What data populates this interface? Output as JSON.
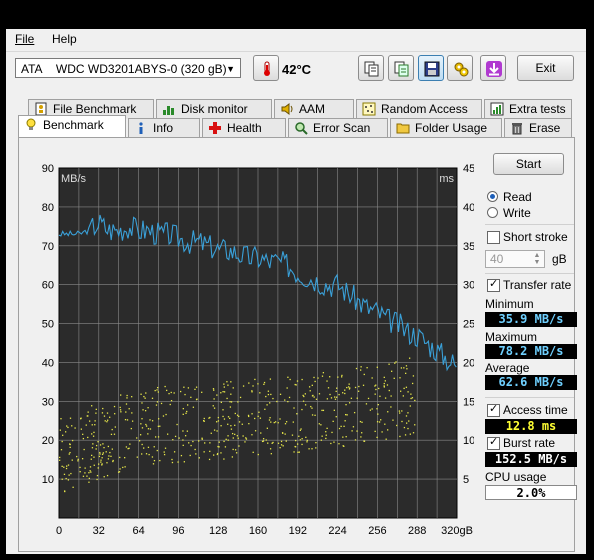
{
  "menu": [
    {
      "label": "File"
    },
    {
      "label": "Help"
    }
  ],
  "drive": {
    "interface": "ATA",
    "model": "WDC WD3201ABYS-0 (320 gB)"
  },
  "temperature": {
    "value": "42",
    "unit": "°C"
  },
  "toolbar": {
    "exit_label": "Exit"
  },
  "tabs_top": [
    "File Benchmark",
    "Disk monitor",
    "AAM",
    "Random Access",
    "Extra tests"
  ],
  "tabs_bottom": [
    "Benchmark",
    "Info",
    "Health",
    "Error Scan",
    "Folder Usage",
    "Erase"
  ],
  "controls": {
    "start_label": "Start",
    "read_label": "Read",
    "write_label": "Write",
    "short_stroke_label": "Short stroke",
    "short_stroke_value": "40",
    "short_stroke_unit": "gB",
    "transfer_rate_label": "Transfer rate",
    "minimum_label": "Minimum",
    "minimum_value": "35.9 MB/s",
    "maximum_label": "Maximum",
    "maximum_value": "78.2 MB/s",
    "average_label": "Average",
    "average_value": "62.6 MB/s",
    "access_time_label": "Access time",
    "access_time_value": "12.8 ms",
    "burst_rate_label": "Burst rate",
    "burst_rate_value": "152.5 MB/s",
    "cpu_usage_label": "CPU usage",
    "cpu_usage_value": "2.0%",
    "mode_selected": "Read",
    "short_stroke_checked": false,
    "transfer_rate_checked": true,
    "access_time_checked": true,
    "burst_rate_checked": true
  },
  "colors": {
    "plot_bg": "#2b2b2b",
    "transfer_line": "#3aa0d8",
    "access_dots": "#e8e84a",
    "min_value": "#6fd0ff",
    "access_value": "#ffff33",
    "burst_value": "#ffffff"
  },
  "chart_data": {
    "type": "line",
    "left_axis_label": "MB/s",
    "right_axis_label": "ms",
    "left_ticks": [
      "90",
      "80",
      "70",
      "60",
      "50",
      "40",
      "30",
      "20",
      "10"
    ],
    "right_ticks": [
      "45",
      "40",
      "35",
      "30",
      "25",
      "20",
      "15",
      "10",
      "5"
    ],
    "x_ticks": [
      "0",
      "32",
      "64",
      "96",
      "128",
      "160",
      "192",
      "224",
      "256",
      "288",
      "320gB"
    ],
    "ylim_left": [
      0,
      90
    ],
    "ylim_right": [
      0,
      45
    ],
    "xlim": [
      0,
      320
    ],
    "series": [
      {
        "kind": "transfer_rate",
        "x": [
          0,
          8,
          16,
          24,
          32,
          40,
          48,
          56,
          64,
          72,
          80,
          88,
          96,
          104,
          112,
          120,
          128,
          136,
          144,
          152,
          160,
          168,
          176,
          184,
          192,
          200,
          208,
          216,
          224,
          232,
          240,
          248,
          256,
          264,
          272,
          280,
          288,
          296,
          304,
          312,
          320
        ],
        "values": [
          73,
          73,
          73,
          74,
          76,
          74,
          74,
          75,
          74,
          74,
          73,
          73,
          72,
          71,
          71,
          70,
          69,
          69,
          68,
          67,
          67,
          66,
          66,
          65,
          63,
          62,
          61,
          60,
          60,
          58,
          56,
          54,
          53,
          51,
          50,
          48,
          47,
          45,
          43,
          41,
          39
        ]
      },
      {
        "kind": "access_time",
        "x": [
          0,
          16,
          32,
          48,
          64,
          80,
          96,
          112,
          128,
          144,
          160,
          176,
          192,
          208,
          224,
          240,
          256,
          272,
          288
        ],
        "values": [
          8,
          9,
          10,
          11,
          11.5,
          12,
          12,
          12.5,
          12.5,
          13,
          13,
          13.5,
          13.5,
          14,
          14,
          14.5,
          15,
          15.5,
          16
        ]
      }
    ],
    "grid": true
  }
}
